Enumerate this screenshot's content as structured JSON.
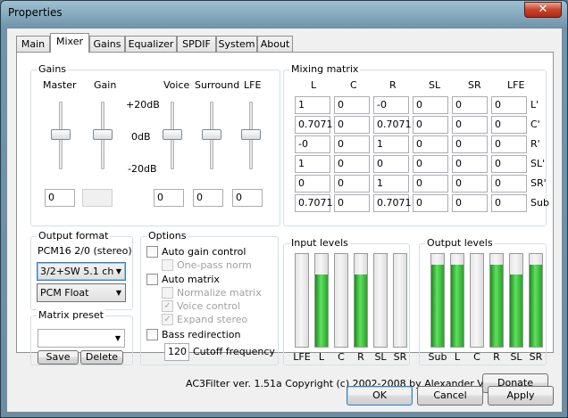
{
  "window": {
    "title": "Properties",
    "close_glyph": "✕"
  },
  "tabs": [
    "Main",
    "Mixer",
    "Gains",
    "Equalizer",
    "SPDIF",
    "System",
    "About"
  ],
  "active_tab": "Mixer",
  "gains": {
    "group_label": "Gains",
    "master_label": "Master",
    "gain_label": "Gain",
    "voice_label": "Voice",
    "surround_label": "Surround",
    "lfe_label": "LFE",
    "scale_top": "+20dB",
    "scale_mid": "0dB",
    "scale_bottom": "-20dB",
    "master_value": "0",
    "gain_value": "0",
    "voice_value": "0",
    "surround_value": "0",
    "lfe_value": "0"
  },
  "mixing_matrix": {
    "group_label": "Mixing matrix",
    "columns": [
      "L",
      "C",
      "R",
      "SL",
      "SR",
      "LFE"
    ],
    "rows": [
      {
        "label": "L'",
        "values": [
          "1",
          "0",
          "-0",
          "0",
          "0",
          "0"
        ]
      },
      {
        "label": "C'",
        "values": [
          "0.7071",
          "0",
          "0.7071",
          "0",
          "0",
          "0"
        ]
      },
      {
        "label": "R'",
        "values": [
          "-0",
          "0",
          "1",
          "0",
          "0",
          "0"
        ]
      },
      {
        "label": "SL'",
        "values": [
          "1",
          "0",
          "0",
          "0",
          "0",
          "0"
        ]
      },
      {
        "label": "SR'",
        "values": [
          "0",
          "0",
          "1",
          "0",
          "0",
          "0"
        ]
      },
      {
        "label": "Sub",
        "values": [
          "0.7071",
          "0",
          "0.7071",
          "0",
          "0",
          "0"
        ]
      }
    ]
  },
  "output_format": {
    "group_label": "Output format",
    "current": "PCM16 2/0 (stereo)",
    "speakers_value": "3/2+SW 5.1 ch",
    "sample_format_value": "PCM Float"
  },
  "matrix_preset": {
    "group_label": "Matrix preset",
    "value": "",
    "save_label": "Save",
    "delete_label": "Delete"
  },
  "options": {
    "group_label": "Options",
    "auto_gain_control": "Auto gain control",
    "one_pass_norm": "One-pass norm",
    "auto_matrix": "Auto matrix",
    "normalize_matrix": "Normalize matrix",
    "voice_control": "Voice control",
    "expand_stereo": "Expand stereo",
    "bass_redirection": "Bass redirection",
    "cutoff_value": "120",
    "cutoff_label": "Cutoff frequency",
    "check_glyph": "✓"
  },
  "input_levels": {
    "group_label": "Input levels",
    "channels": [
      {
        "label": "LFE",
        "level": 0.0
      },
      {
        "label": "L",
        "level": 0.78
      },
      {
        "label": "C",
        "level": 0.0
      },
      {
        "label": "R",
        "level": 0.78
      },
      {
        "label": "SL",
        "level": 0.0
      },
      {
        "label": "SR",
        "level": 0.0
      }
    ]
  },
  "output_levels": {
    "group_label": "Output levels",
    "channels": [
      {
        "label": "Sub",
        "level": 0.88
      },
      {
        "label": "L",
        "level": 0.88
      },
      {
        "label": "C",
        "level": 0.0
      },
      {
        "label": "R",
        "level": 0.88
      },
      {
        "label": "SL",
        "level": 0.78
      },
      {
        "label": "SR",
        "level": 0.88
      }
    ],
    "meter_color": "#3cc43c"
  },
  "footer": {
    "copyright": "AC3Filter ver. 1.51a Copyright (c) 2002-2008 by Alexander Vigovsky",
    "donate_label": "Donate"
  },
  "dialog_buttons": {
    "ok": "OK",
    "cancel": "Cancel",
    "apply": "Apply"
  }
}
